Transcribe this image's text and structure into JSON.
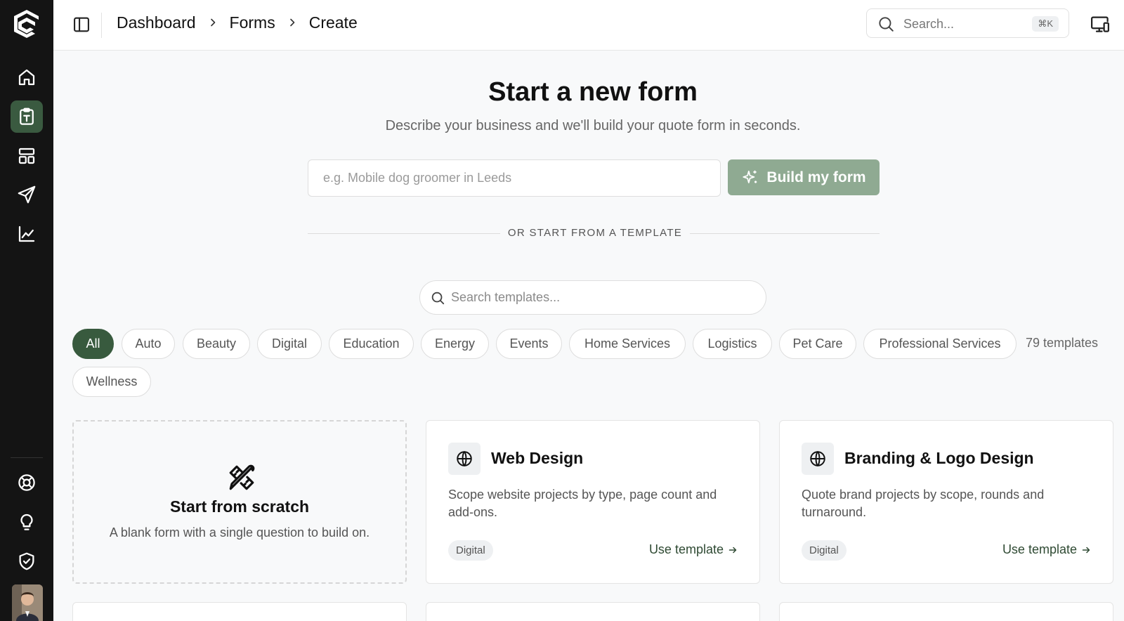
{
  "header": {
    "breadcrumb": [
      "Dashboard",
      "Forms",
      "Create"
    ],
    "search_placeholder": "Search...",
    "search_shortcut": "⌘K"
  },
  "sidebar": {
    "icons": [
      "home-icon",
      "forms-icon",
      "templates-icon",
      "send-icon",
      "analytics-icon",
      "help-icon",
      "lightbulb-icon",
      "shield-icon"
    ],
    "active": "forms-icon"
  },
  "main": {
    "title": "Start a new form",
    "subtitle": "Describe your business and we'll build your quote form in seconds.",
    "prompt_placeholder": "e.g. Mobile dog groomer in Leeds",
    "build_button": "Build my form",
    "divider_label": "OR START FROM A TEMPLATE",
    "template_search_placeholder": "Search templates...",
    "filters": [
      "All",
      "Auto",
      "Beauty",
      "Digital",
      "Education",
      "Energy",
      "Events",
      "Home Services",
      "Logistics",
      "Pet Care",
      "Professional Services",
      "Wellness"
    ],
    "active_filter": "All",
    "template_count": "79 templates"
  },
  "cards": {
    "scratch": {
      "title": "Start from scratch",
      "description": "A blank form with a single question to build on."
    },
    "templates": [
      {
        "title": "Web Design",
        "description": "Scope website projects by type, page count and add-ons.",
        "category": "Digital",
        "action": "Use template"
      },
      {
        "title": "Branding & Logo Design",
        "description": "Quote brand projects by scope, rounds and turnaround.",
        "category": "Digital",
        "action": "Use template"
      }
    ]
  },
  "colors": {
    "accent": "#385a3e",
    "build_button": "#8faa92",
    "sidebar": "#141414"
  }
}
